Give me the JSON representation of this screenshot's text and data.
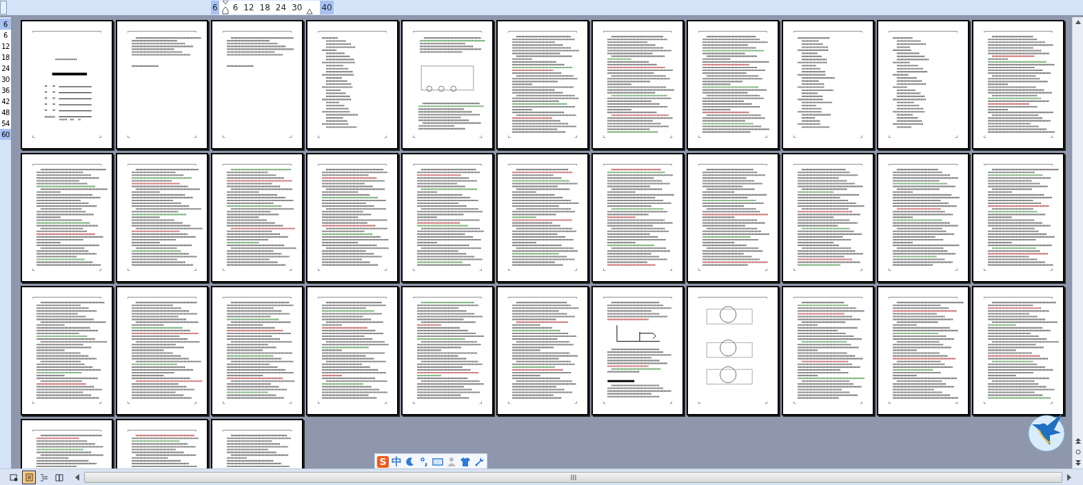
{
  "ruler": {
    "labels": [
      {
        "text": "6",
        "margin": true
      },
      {
        "text": "6",
        "margin": false
      },
      {
        "text": "12",
        "margin": false
      },
      {
        "text": "18",
        "margin": false
      },
      {
        "text": "24",
        "margin": false
      },
      {
        "text": "30",
        "margin": false
      },
      {
        "text": "40",
        "margin": true
      }
    ]
  },
  "vertical_ruler": {
    "labels": [
      {
        "text": "6",
        "margin": true
      },
      {
        "text": "6",
        "margin": false
      },
      {
        "text": "12",
        "margin": false
      },
      {
        "text": "18",
        "margin": false
      },
      {
        "text": "24",
        "margin": false
      },
      {
        "text": "30",
        "margin": false
      },
      {
        "text": "36",
        "margin": false
      },
      {
        "text": "42",
        "margin": false
      },
      {
        "text": "48",
        "margin": false
      },
      {
        "text": "54",
        "margin": false
      },
      {
        "text": "60",
        "margin": true
      }
    ]
  },
  "pages": [
    {
      "kind": "cover"
    },
    {
      "kind": "short"
    },
    {
      "kind": "short"
    },
    {
      "kind": "list"
    },
    {
      "kind": "figure"
    },
    {
      "kind": "text"
    },
    {
      "kind": "text"
    },
    {
      "kind": "text"
    },
    {
      "kind": "list"
    },
    {
      "kind": "list"
    },
    {
      "kind": "text"
    },
    {
      "kind": "text"
    },
    {
      "kind": "text"
    },
    {
      "kind": "text"
    },
    {
      "kind": "text"
    },
    {
      "kind": "text"
    },
    {
      "kind": "text"
    },
    {
      "kind": "text"
    },
    {
      "kind": "text"
    },
    {
      "kind": "text"
    },
    {
      "kind": "text"
    },
    {
      "kind": "text"
    },
    {
      "kind": "text"
    },
    {
      "kind": "text"
    },
    {
      "kind": "text"
    },
    {
      "kind": "text"
    },
    {
      "kind": "text"
    },
    {
      "kind": "text"
    },
    {
      "kind": "chart"
    },
    {
      "kind": "circles"
    },
    {
      "kind": "text"
    },
    {
      "kind": "text"
    },
    {
      "kind": "text"
    },
    {
      "kind": "text"
    },
    {
      "kind": "text"
    },
    {
      "kind": "text"
    }
  ],
  "ime_toolbar": {
    "logo": "S",
    "mode": "中"
  },
  "view_buttons": [
    {
      "selected": false
    },
    {
      "selected": true
    },
    {
      "selected": false
    },
    {
      "selected": false
    }
  ]
}
